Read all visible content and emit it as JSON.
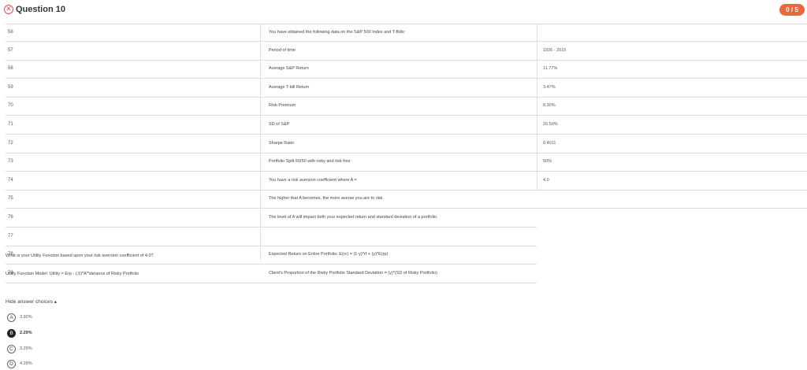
{
  "header": {
    "icon": "x-circle-icon",
    "title": "Question 10",
    "score": "0 / 5",
    "score_color": "#e8693f"
  },
  "rows": [
    {
      "num": "56",
      "desc": "You have obtained the following data on the S&P 500 Index and T-Bills:",
      "val": ""
    },
    {
      "num": "57",
      "desc": "Period of time",
      "val": "1926 - 2015"
    },
    {
      "num": "58",
      "desc": "Average S&P Return",
      "val": "11.77%"
    },
    {
      "num": "59",
      "desc": "Average T-bill Return",
      "val": "3.47%"
    },
    {
      "num": "70",
      "desc": "Risk Premium",
      "val": "8.30%"
    },
    {
      "num": "71",
      "desc": "SD of S&P",
      "val": "20.50%"
    },
    {
      "num": "72",
      "desc": "Sharpe Ratio",
      "val": "0.4011"
    },
    {
      "num": "73",
      "desc": "Portfolio Split 50/50 with risky and risk free",
      "val": "50%"
    },
    {
      "num": "74",
      "desc": "You have a risk aversion coefficient where A =",
      "val": "4.0"
    },
    {
      "num": "75",
      "desc": "The higher that A becomes, the more averse you are to risk.",
      "val": ""
    },
    {
      "num": "76",
      "desc": "The level of A will impact both your expected return and standard deviation of a portfolio.",
      "val": ""
    },
    {
      "num": "77",
      "desc": "",
      "val": ""
    },
    {
      "num": "78",
      "desc": "Expected Return on Entire Portfolio: E(rc) = (1-y)*rf + (y)*E(rp)",
      "val": ""
    },
    {
      "num": "79",
      "desc": "Client's Proportion of the Risky Portfolio Standard Deviation = (y)*(SD of Risky Portfolio)",
      "val": ""
    }
  ],
  "question": {
    "prompt": "What is your Utility Function based upon your risk aversion coefficient of 4.0?",
    "model": "Utility Function Model: Utility = Erp - (.5)*A*Variance of Risky Portfolio"
  },
  "choices": {
    "toggle_label": "Hide answer choices ▴",
    "items": [
      {
        "letter": "A",
        "text": "3.92%",
        "selected": false
      },
      {
        "letter": "B",
        "text": "2.29%",
        "selected": true
      },
      {
        "letter": "C",
        "text": "3.29%",
        "selected": false
      },
      {
        "letter": "D",
        "text": "4.29%",
        "selected": false
      }
    ]
  }
}
